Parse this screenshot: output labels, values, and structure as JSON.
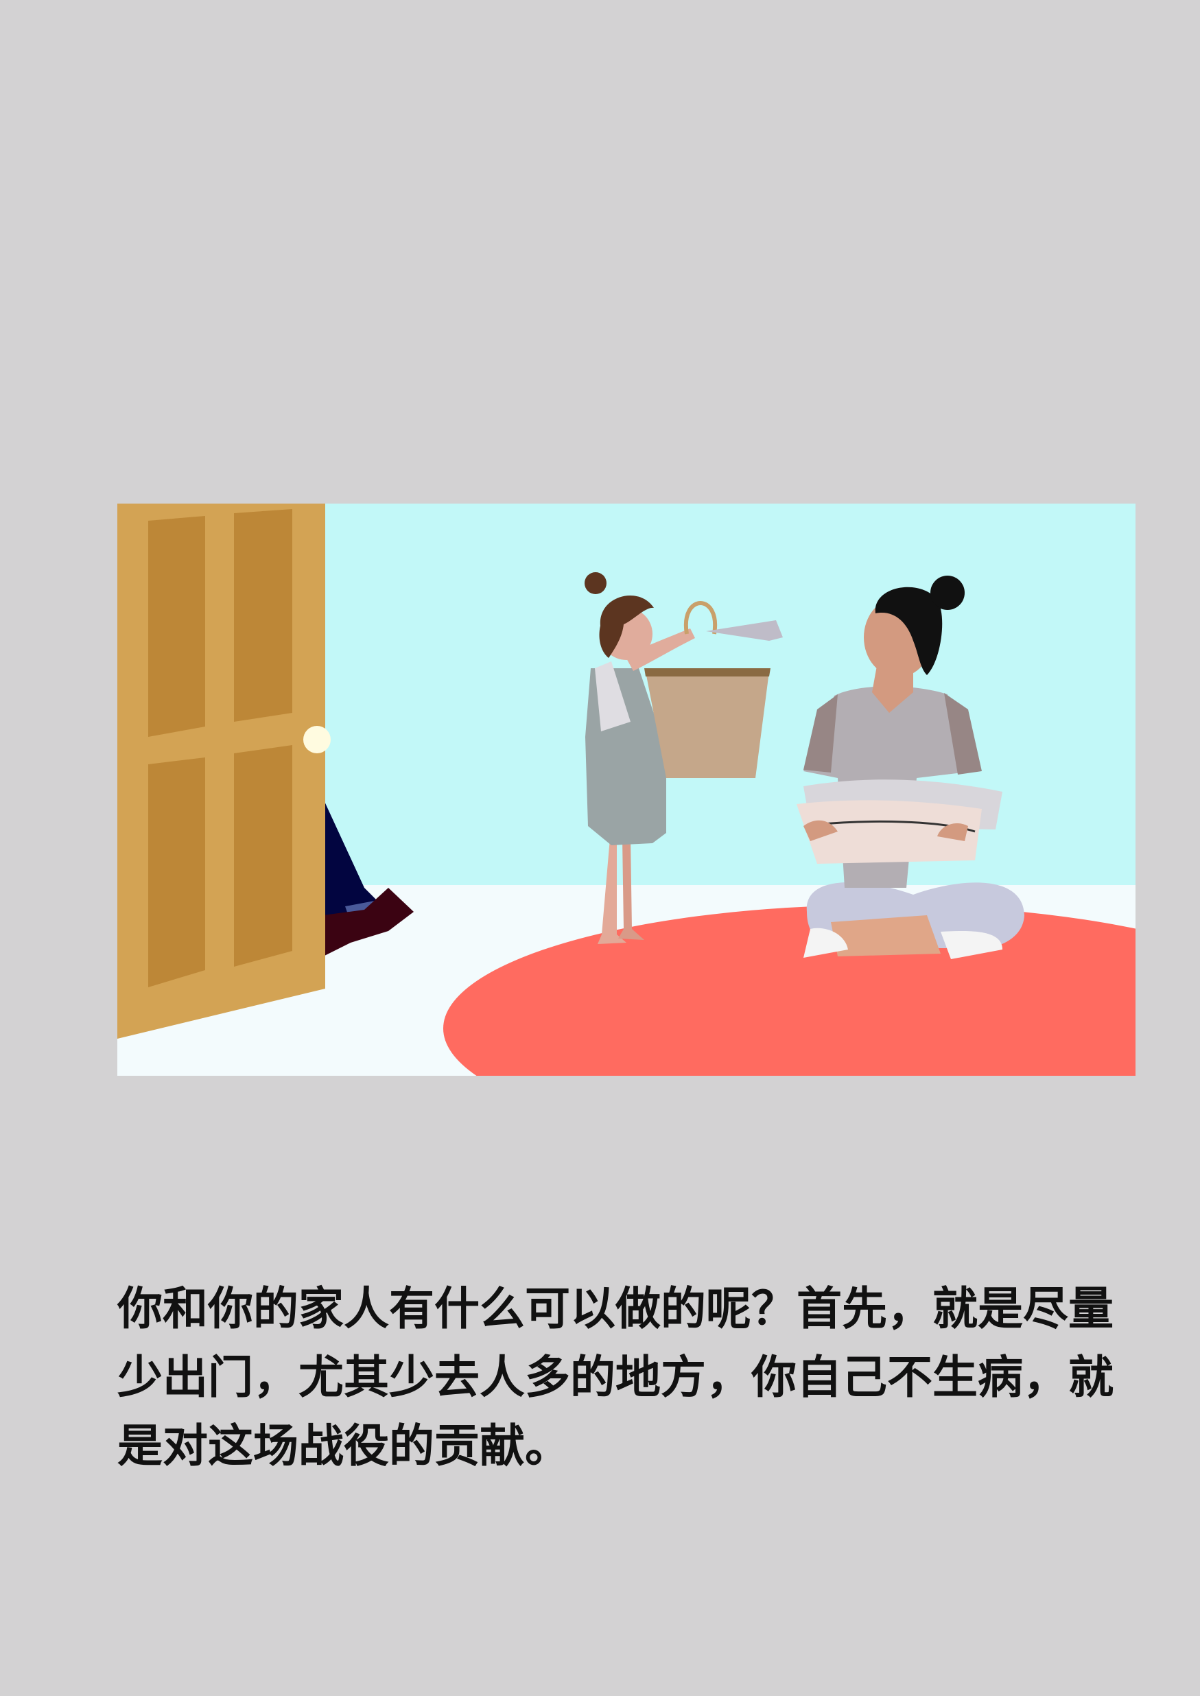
{
  "page": {
    "background_color": "#d3d2d3"
  },
  "illustration": {
    "subject": "family-at-home-folding-laundry",
    "colors": {
      "wall": "#c2f8f8",
      "floor": "#f3fbfd",
      "rug": "#ff6b60",
      "door": "#d3a354",
      "door_panel": "#bd8737",
      "knob": "#fffbe0"
    }
  },
  "caption": {
    "lines": [
      "你和你的家人有什么可以做的呢？首先，就是尽量",
      "少出门，尤其少去人多的地方，你自己不生病，就",
      "是对这场战役的贡献。"
    ]
  }
}
